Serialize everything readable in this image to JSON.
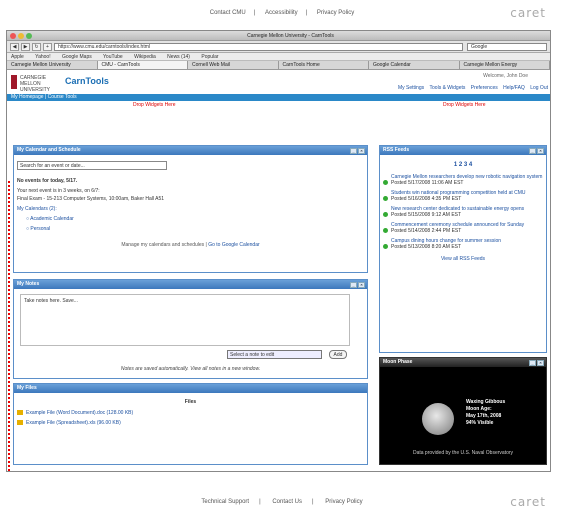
{
  "top_links": [
    "Contact CMU",
    "Accessibility",
    "Privacy Policy"
  ],
  "brand_word": "caret",
  "browser": {
    "title": "Carnegie Mellon University - CarnTools",
    "url": "https://www.cmu.edu/carntools/index.html",
    "search_placeholder": "Google",
    "bookmarks": [
      "Apple",
      "Yahoo!",
      "Google Maps",
      "YouTube",
      "Wikipedia",
      "News (14)",
      "Popular"
    ],
    "tabs": [
      "Carnegie Mellon University",
      "CMU - CarnTools",
      "Cornell Web Mail",
      "CarnTools Home",
      "Google Calendar",
      "Carnegie Mellon Energy"
    ]
  },
  "header": {
    "logo_text": "CARNEGIE MELLON UNIVERSITY",
    "app_title": "CarnTools",
    "welcome": "Welcome, John Doe",
    "links": [
      "My Settings",
      "Tools & Widgets",
      "Preferences",
      "Help/FAQ",
      "Log Out"
    ],
    "nav": "My Homepage | Course Tools",
    "drop_left": "Drop Widgets Here",
    "drop_right": "Drop Widgets Here"
  },
  "calendar": {
    "title": "My Calendar and Schedule",
    "search_placeholder": "Search for an event or date...",
    "no_events": "No events for today, 5/17.",
    "line1": "Your next event is in 3 weeks, on 6/7:",
    "line2": "Final Exam - 15-213 Computer Systems, 10:00am, Baker Hall A51",
    "my_cal_label": "My Calendars (2):",
    "calendars": [
      "Academic Calendar",
      "Personal"
    ],
    "footer": "Manage my calendars and schedules |",
    "footer_link": "Go to Google Calendar"
  },
  "notes": {
    "title": "My Notes",
    "placeholder": "Take notes here.\n\nSave...",
    "select_label": "Select a note to edit",
    "add_label": "Add",
    "footer": "Notes are saved automatically. View all notes in a new window."
  },
  "files": {
    "title": "My Files",
    "header": "Files",
    "rows": [
      "Example File (Word Document).doc (128.00 KB)",
      "Example File (Spreadsheet).xls (96.00 KB)"
    ]
  },
  "rss": {
    "title": "RSS Feeds",
    "count": "1 2 3 4",
    "items": [
      {
        "title": "Carnegie Mellon researchers develop new robotic navigation system",
        "date": "Posted 5/17/2008 11:06 AM EST"
      },
      {
        "title": "Students win national programming competition held at CMU",
        "date": "Posted 5/16/2008 4:35 PM EST"
      },
      {
        "title": "New research center dedicated to sustainable energy opens",
        "date": "Posted 5/15/2008 9:12 AM EST"
      },
      {
        "title": "Commencement ceremony schedule announced for Sunday",
        "date": "Posted 5/14/2008 2:44 PM EST"
      },
      {
        "title": "Campus dining hours change for summer session",
        "date": "Posted 5/13/2008 8:20 AM EST"
      }
    ],
    "more": "View all RSS Feeds"
  },
  "moon": {
    "title": "Moon Phase",
    "lines": [
      "Waxing Gibbous",
      "Moon Age:",
      "May 17th, 2008",
      "94% Visible"
    ],
    "footer": "Data provided by the U.S. Naval Observatory"
  },
  "bottom_links": [
    "Technical Support",
    "Contact Us",
    "Privacy Policy"
  ]
}
